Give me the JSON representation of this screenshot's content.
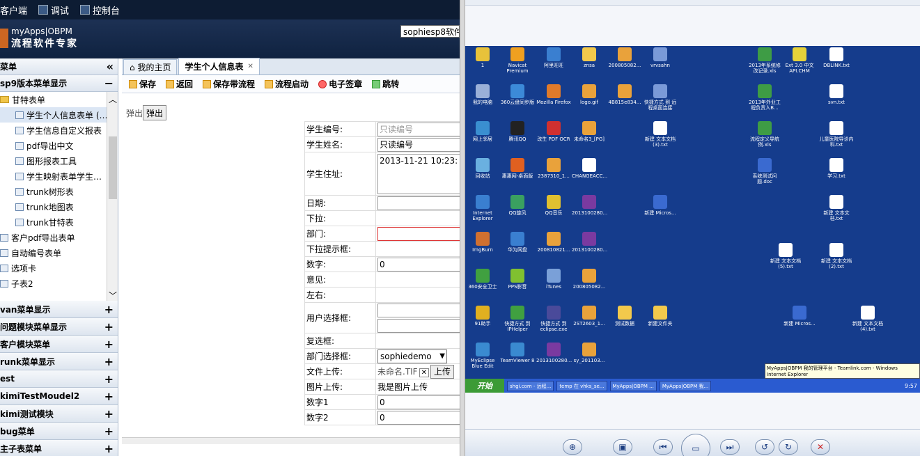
{
  "topbar": {
    "items": [
      {
        "label": "客户端"
      },
      {
        "label": "调试"
      },
      {
        "label": "控制台"
      }
    ]
  },
  "header": {
    "logo_line1": "myApps|OBPM",
    "logo_line2": "流程软件专家",
    "user_selector": "sophiesp8软件"
  },
  "sidebar": {
    "title": "菜单",
    "collapse_icon": "«",
    "group_open": "sp9版本菜单显示",
    "tree": [
      {
        "label": "甘特表单",
        "kind": "folder",
        "indent": 0
      },
      {
        "label": "学生个人信息表单 (…",
        "kind": "form",
        "indent": 1,
        "selected": true
      },
      {
        "label": "学生信息自定义报表",
        "kind": "form",
        "indent": 1
      },
      {
        "label": "pdf导出中文",
        "kind": "form",
        "indent": 1
      },
      {
        "label": "图形报表工具",
        "kind": "form",
        "indent": 1
      },
      {
        "label": "学生映射表单学生…",
        "kind": "form",
        "indent": 1
      },
      {
        "label": "trunk树形表",
        "kind": "form",
        "indent": 1
      },
      {
        "label": "trunk地图表",
        "kind": "form",
        "indent": 1
      },
      {
        "label": "trunk甘特表",
        "kind": "form",
        "indent": 1
      },
      {
        "label": "客户pdf导出表单",
        "kind": "form",
        "indent": 0
      },
      {
        "label": "自动编号表单",
        "kind": "form",
        "indent": 0
      },
      {
        "label": "选项卡",
        "kind": "form",
        "indent": 0
      },
      {
        "label": "子表2",
        "kind": "form",
        "indent": 0
      }
    ],
    "groups": [
      {
        "label": "van菜单显示"
      },
      {
        "label": "问题模块菜单显示"
      },
      {
        "label": "客户模块菜单"
      },
      {
        "label": "runk菜单显示"
      },
      {
        "label": "est"
      },
      {
        "label": "kimiTestMoudel2"
      },
      {
        "label": "kimi测试模块"
      },
      {
        "label": "bug菜单"
      },
      {
        "label": "主子表菜单"
      }
    ]
  },
  "tabs": [
    {
      "label": "我的主页",
      "active": false
    },
    {
      "label": "学生个人信息表",
      "active": true
    }
  ],
  "toolbar": [
    {
      "label": "保存"
    },
    {
      "label": "返回"
    },
    {
      "label": "保存带流程"
    },
    {
      "label": "流程启动"
    },
    {
      "label": "电子签章"
    },
    {
      "label": "跳转"
    }
  ],
  "popup": {
    "text": "弹出",
    "button": "弹出"
  },
  "form": {
    "student_no_label": "学生编号:",
    "student_no_value": "只读编号",
    "student_name_label": "学生姓名:",
    "student_name_value": "只读编号",
    "address_label": "学生住址:",
    "address_value": "2013-11-21 10:23:",
    "date_label": "日期:",
    "dropdown_label": "下拉:",
    "dept_label": "部门:",
    "dropdown_hint_label": "下拉提示框:",
    "number_label": "数字:",
    "number_value": "0",
    "opinion_label": "意见:",
    "leftright_label": "左右:",
    "user_select_label": "用户选择框:",
    "checkbox_label": "复选框:",
    "dept_select_label": "部门选择框:",
    "dept_select_value": "sophiedemo",
    "file_upload_label": "文件上传:",
    "file_upload_value": "未命名.TIF",
    "upload_button": "上传",
    "image_upload_label": "图片上传:",
    "image_upload_value": "我是图片上传",
    "number1_label": "数字1",
    "number1_value": "0",
    "number2_label": "数字2",
    "number2_value": "0"
  },
  "desktop": {
    "icons": [
      {
        "label": "1",
        "color": "#e8c23a"
      },
      {
        "label": "Navicat Premium",
        "color": "#f0a020"
      },
      {
        "label": "阿里旺旺",
        "color": "#3a7fd0"
      },
      {
        "label": "znsa",
        "color": "#f2c94c"
      },
      {
        "label": "200805082...",
        "color": "#e9a23b"
      },
      {
        "label": "vrvsahn",
        "color": "#7a9ad8"
      },
      {
        "label": "2013年系统修改记录.xls",
        "color": "#3e9c45"
      },
      {
        "label": "Ext 3.0 中文API.CHM",
        "color": "#e6d23a"
      },
      {
        "label": "DBLINK.txt",
        "color": "#ffffff"
      },
      {
        "label": "我的电脑",
        "color": "#9ab0d8"
      },
      {
        "label": "360云盘同步版",
        "color": "#3c8ad8"
      },
      {
        "label": "Mozilla Firefox",
        "color": "#e07a2a"
      },
      {
        "label": "logo.gif",
        "color": "#e9a23b"
      },
      {
        "label": "4B815e834...",
        "color": "#e9a23b"
      },
      {
        "label": "快捷方式 到 远程桌面连接",
        "color": "#7a9ad8"
      },
      {
        "label": "2013年外业工程负责人B...",
        "color": "#3e9c45"
      },
      {
        "label": "svn.txt",
        "color": "#ffffff"
      },
      {
        "label": "网上邻居",
        "color": "#3a8fd0"
      },
      {
        "label": "腾讯QQ",
        "color": "#222222"
      },
      {
        "label": "改生 PDF OCR",
        "color": "#d03030"
      },
      {
        "label": "未命名3_[PG]",
        "color": "#e9a23b"
      },
      {
        "label": "新建 文本文档 (3).txt",
        "color": "#ffffff"
      },
      {
        "label": "流程定义导航例.xls",
        "color": "#3e9c45"
      },
      {
        "label": "儿童医院导诊内科.txt",
        "color": "#ffffff"
      },
      {
        "label": "回收站",
        "color": "#6ab0e0"
      },
      {
        "label": "惠惠网-桌面版",
        "color": "#e06020"
      },
      {
        "label": "2387310_1...",
        "color": "#e9a23b"
      },
      {
        "label": "CHANGEACC...",
        "color": "#ffffff"
      },
      {
        "label": "系统测试问题.doc",
        "color": "#3a6ad0"
      },
      {
        "label": "学习.txt",
        "color": "#ffffff"
      },
      {
        "label": "Internet Explorer",
        "color": "#3a7fd0"
      },
      {
        "label": "QQ旋风",
        "color": "#3aa060"
      },
      {
        "label": "QQ音乐",
        "color": "#e0c030"
      },
      {
        "label": "2013100280...",
        "color": "#7a3aa0"
      },
      {
        "label": "新建 Micros...",
        "color": "#3a6ad0"
      },
      {
        "label": "新建 文本文档.txt",
        "color": "#ffffff"
      },
      {
        "label": "ImgBurn",
        "color": "#d07030"
      },
      {
        "label": "华为网盘",
        "color": "#3a7fd0"
      },
      {
        "label": "200810821...",
        "color": "#e9a23b"
      },
      {
        "label": "2013100280...",
        "color": "#7a3aa0"
      },
      {
        "label": "新建 文本文档 (5).txt",
        "color": "#ffffff"
      },
      {
        "label": "新建 文本文档 (2).txt",
        "color": "#ffffff"
      },
      {
        "label": "360安全卫士",
        "color": "#40a040"
      },
      {
        "label": "PPS影音",
        "color": "#80c030"
      },
      {
        "label": "iTunes",
        "color": "#7aa0d8"
      },
      {
        "label": "200805082...",
        "color": "#e9a23b"
      },
      {
        "label": "91助手",
        "color": "#e0b020"
      },
      {
        "label": "快捷方式 到 IPHelper",
        "color": "#40a040"
      },
      {
        "label": "快捷方式 到 eclipse.exe",
        "color": "#4a4a9a"
      },
      {
        "label": "2ST2603_1...",
        "color": "#e9a23b"
      },
      {
        "label": "测试数据",
        "color": "#f2c94c"
      },
      {
        "label": "新建文件夹",
        "color": "#f2c94c"
      },
      {
        "label": "新建 Micros...",
        "color": "#3a6ad0"
      },
      {
        "label": "新建 文本文档 (4).txt",
        "color": "#ffffff"
      },
      {
        "label": "MyEclipse Blue Edit",
        "color": "#3a8ad0"
      },
      {
        "label": "TeamViewer 8",
        "color": "#3a8ad0"
      },
      {
        "label": "2013100280...",
        "color": "#7a3aa0"
      },
      {
        "label": "sy_201103...",
        "color": "#e9a23b"
      }
    ],
    "start_label": "开始",
    "taskbar_items": [
      {
        "label": "shgi.com - 远程..."
      },
      {
        "label": "temp 在 vhks_se..."
      },
      {
        "label": "MyApps|OBPM ..."
      },
      {
        "label": "MyApps|OBPM 我..."
      }
    ],
    "tooltip": "MyApps|OBPM 我的管理平台 - Teamlink.com - Windows Internet Explorer",
    "clock": "9:57"
  }
}
